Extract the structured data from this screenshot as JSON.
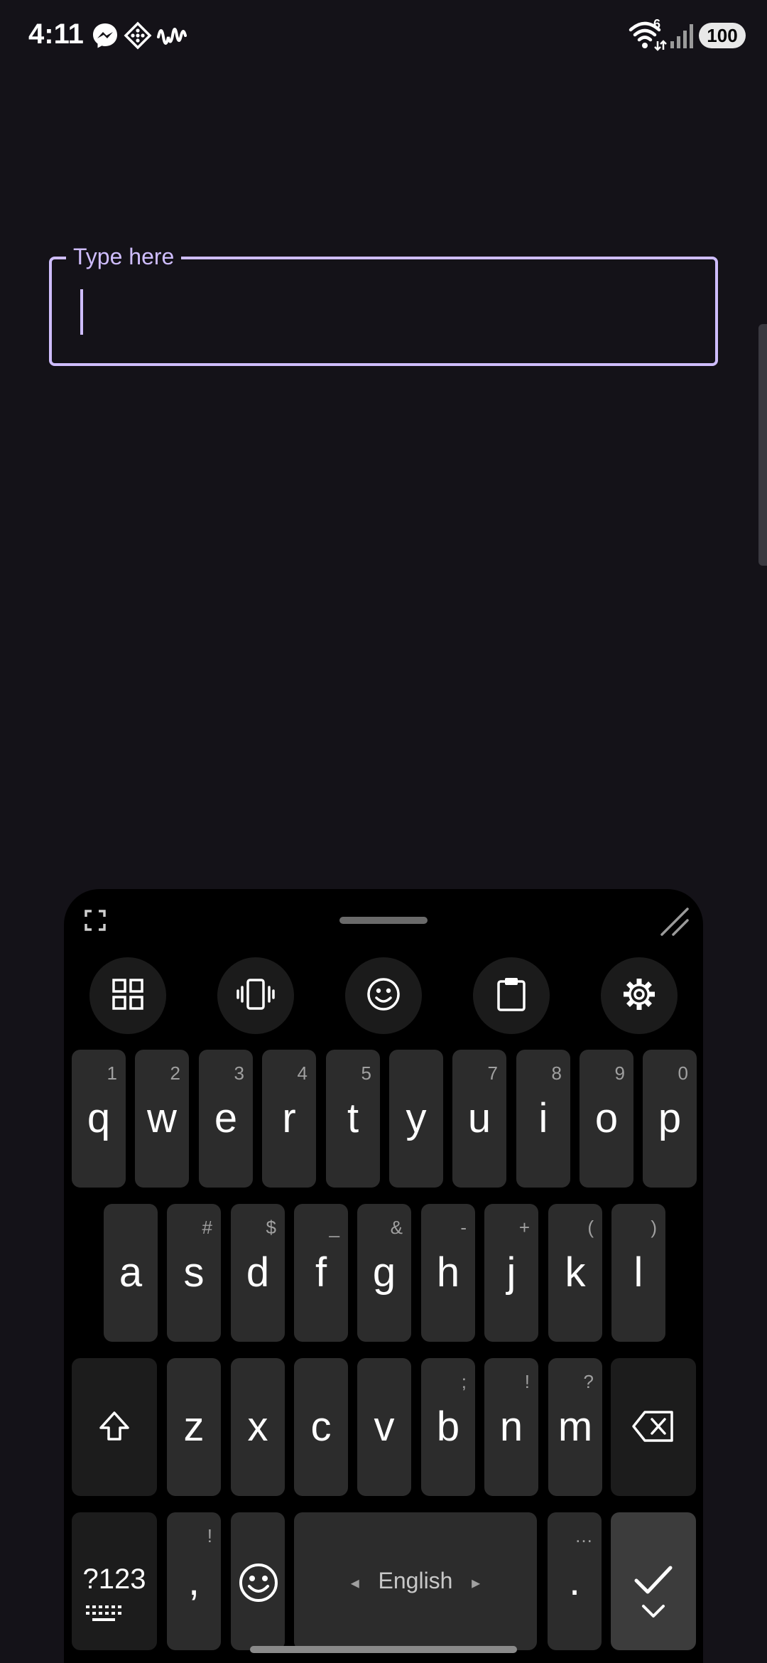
{
  "status_bar": {
    "time": "4:11",
    "battery": "100",
    "wifi_badge": "6",
    "notification_icons": [
      "messenger-icon",
      "app-diamond-icon",
      "waveform-icon"
    ]
  },
  "text_field": {
    "label": "Type here",
    "value": ""
  },
  "keyboard": {
    "toolbar": [
      "apps-grid-icon",
      "vibrate-icon",
      "emoji-icon",
      "clipboard-icon",
      "settings-gear-icon"
    ],
    "row1": [
      {
        "key": "q",
        "hint": "1"
      },
      {
        "key": "w",
        "hint": "2"
      },
      {
        "key": "e",
        "hint": "3"
      },
      {
        "key": "r",
        "hint": "4"
      },
      {
        "key": "t",
        "hint": "5"
      },
      {
        "key": "y",
        "hint": ""
      },
      {
        "key": "u",
        "hint": "7"
      },
      {
        "key": "i",
        "hint": "8"
      },
      {
        "key": "o",
        "hint": "9"
      },
      {
        "key": "p",
        "hint": "0"
      }
    ],
    "row2": [
      {
        "key": "a",
        "hint": ""
      },
      {
        "key": "s",
        "hint": "#"
      },
      {
        "key": "d",
        "hint": "$"
      },
      {
        "key": "f",
        "hint": "_"
      },
      {
        "key": "g",
        "hint": "&"
      },
      {
        "key": "h",
        "hint": "-"
      },
      {
        "key": "j",
        "hint": "+"
      },
      {
        "key": "k",
        "hint": "("
      },
      {
        "key": "l",
        "hint": ")"
      }
    ],
    "row3": [
      {
        "key": "z",
        "hint": ""
      },
      {
        "key": "x",
        "hint": ""
      },
      {
        "key": "c",
        "hint": ""
      },
      {
        "key": "v",
        "hint": ""
      },
      {
        "key": "b",
        "hint": ";"
      },
      {
        "key": "n",
        "hint": "!"
      },
      {
        "key": "m",
        "hint": "?"
      }
    ],
    "symbols_label": "?123",
    "comma": ",",
    "comma_hint": "!",
    "space_label": "English",
    "space_left_arrow": "◂",
    "space_right_arrow": "▸",
    "period": ".",
    "period_hint": "…"
  }
}
